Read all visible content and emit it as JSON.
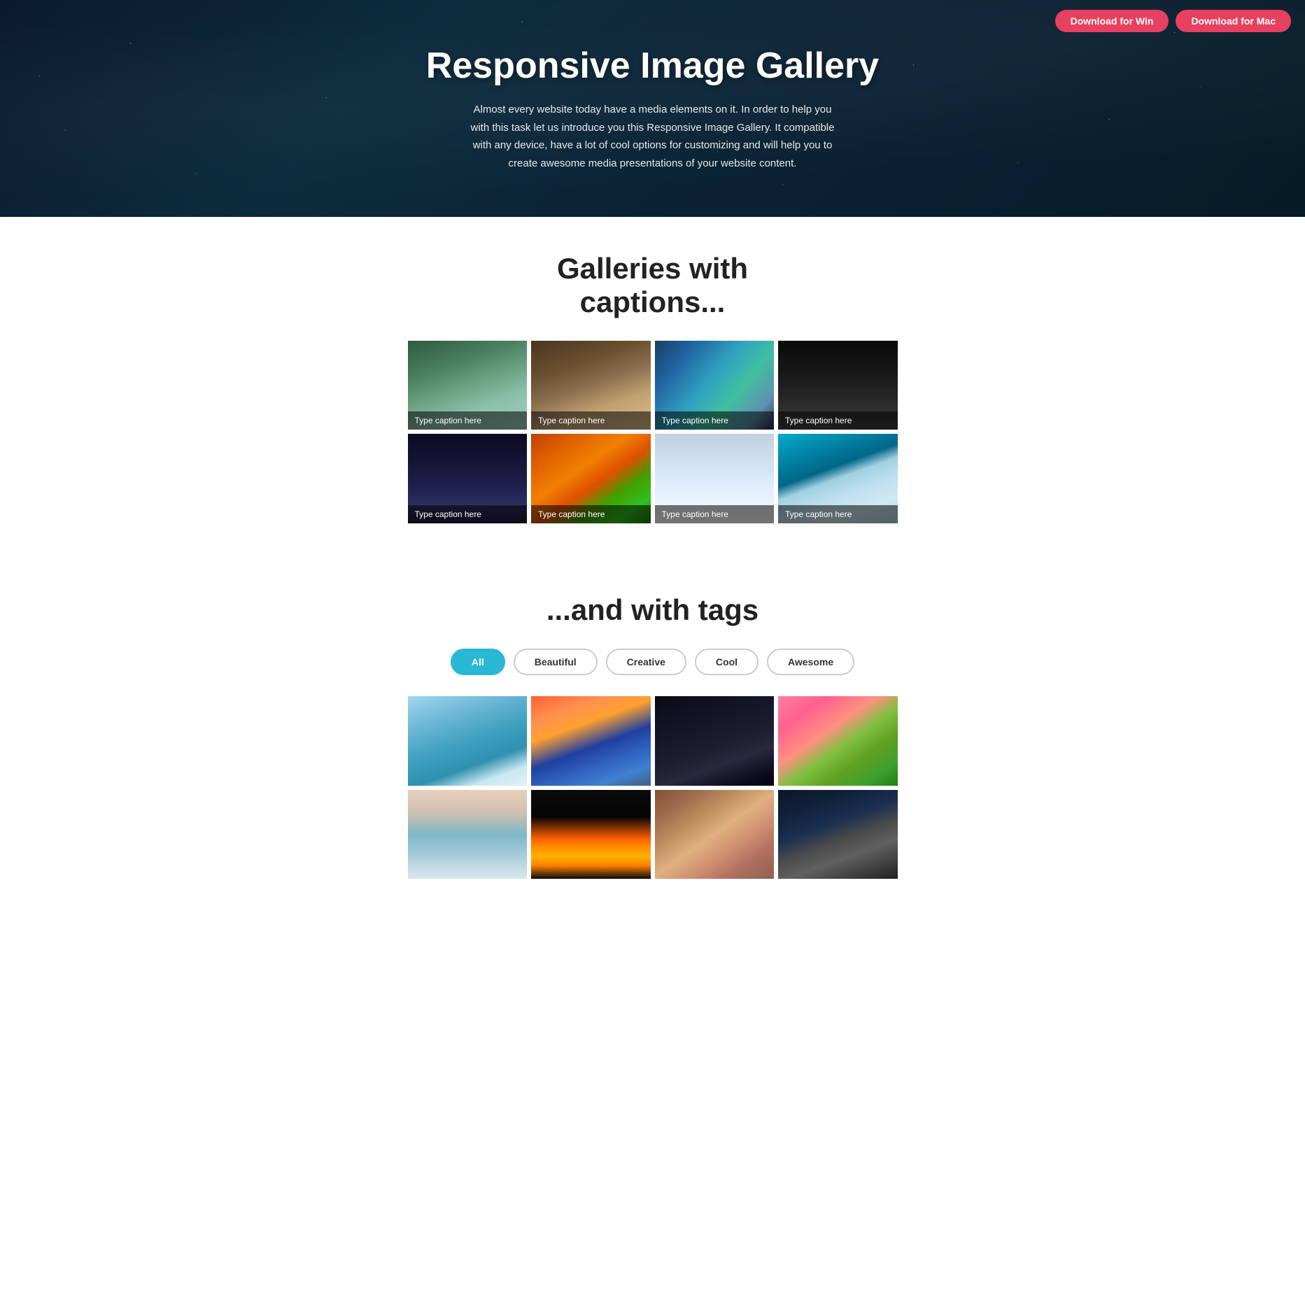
{
  "header": {
    "title": "Responsive Image Gallery",
    "description": "Almost every website today have a media elements on it. In order to help you with this task let us introduce you this Responsive Image Gallery. It compatible with any device, have a lot of cool options for customizing and will help you to create awesome media presentations of your website content.",
    "btn_win": "Download for Win",
    "btn_mac": "Download for Mac"
  },
  "captions_section": {
    "title": "Galleries with\ncaptions..."
  },
  "gallery_items": [
    {
      "caption": "Type caption here",
      "img_class": "img-forest"
    },
    {
      "caption": "Type caption here",
      "img_class": "img-building"
    },
    {
      "caption": "Type caption here",
      "img_class": "img-peacock"
    },
    {
      "caption": "Type caption here",
      "img_class": "img-walkway"
    },
    {
      "caption": "Type caption here",
      "img_class": "img-house-night"
    },
    {
      "caption": "Type caption here",
      "img_class": "img-fruits"
    },
    {
      "caption": "Type caption here",
      "img_class": "img-snow"
    },
    {
      "caption": "Type caption here",
      "img_class": "img-city"
    }
  ],
  "tags_section": {
    "title": "...and with tags",
    "tags": [
      {
        "label": "All",
        "active": true
      },
      {
        "label": "Beautiful",
        "active": false
      },
      {
        "label": "Creative",
        "active": false
      },
      {
        "label": "Cool",
        "active": false
      },
      {
        "label": "Awesome",
        "active": false
      }
    ]
  },
  "bottom_gallery": [
    {
      "img_class": "img-lake-blue"
    },
    {
      "img_class": "img-mountain-sunset"
    },
    {
      "img_class": "img-dark-city"
    },
    {
      "img_class": "img-cherry"
    },
    {
      "img_class": "img-pier"
    },
    {
      "img_class": "img-fire"
    },
    {
      "img_class": "img-bokeh"
    },
    {
      "img_class": "img-rock-ocean"
    }
  ]
}
